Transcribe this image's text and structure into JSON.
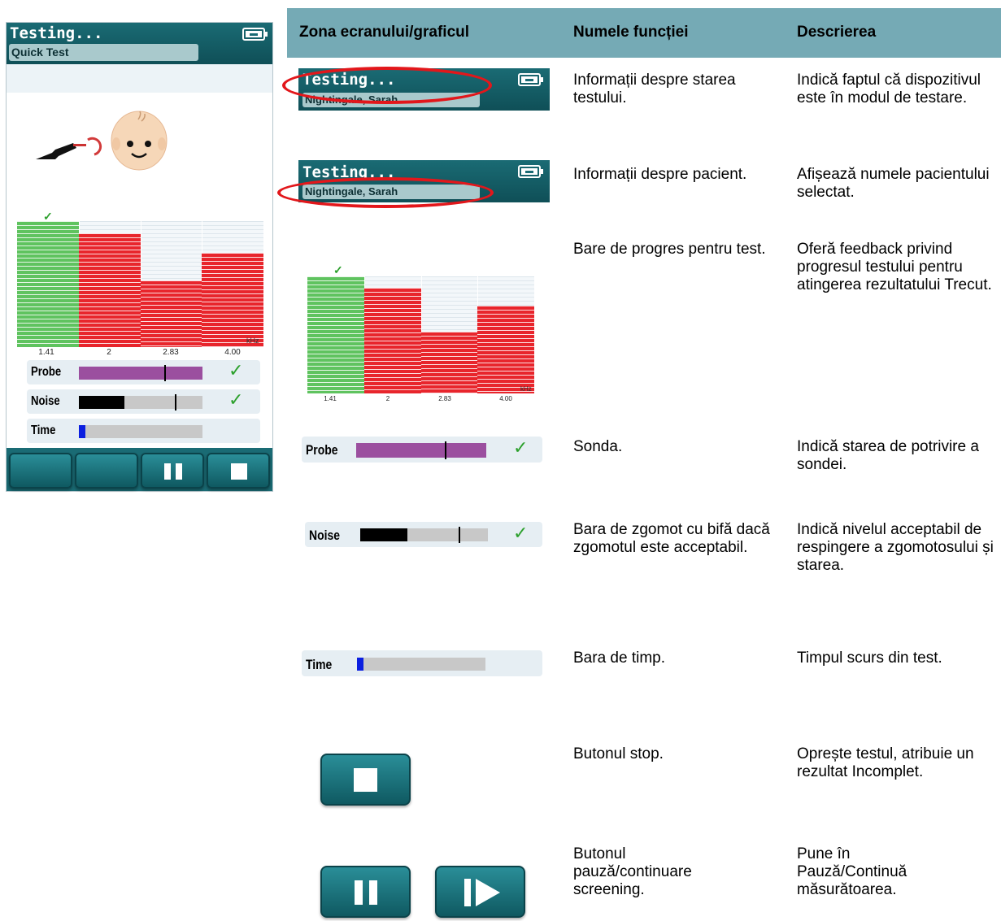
{
  "device": {
    "title": "Testing...",
    "subtitle": "Quick Test",
    "chart_labels": [
      "1.41",
      "2",
      "2.83",
      "4.00"
    ],
    "unit": "kHz",
    "rows": [
      {
        "label": "Probe"
      },
      {
        "label": "Noise"
      },
      {
        "label": "Time"
      }
    ]
  },
  "table": {
    "headers": [
      "Zona ecranului/graficul",
      "Numele funcției",
      "Descrierea"
    ],
    "rows": [
      {
        "name": "Informații despre starea testului.",
        "desc": "Indică faptul că dispozitivul este în modul de testare."
      },
      {
        "name": "Informații despre pacient.",
        "desc": "Afișează numele pacientului selectat."
      },
      {
        "name": "Bare de progres pentru test.",
        "desc": "Oferă feedback privind progresul testului pentru atingerea rezultatului Trecut."
      },
      {
        "name": "Sonda.",
        "desc": "Indică starea de potrivire a sondei."
      },
      {
        "name": "Bara de zgomot cu bifă dacă zgomotul este acceptabil.",
        "desc": "Indică nivelul acceptabil de respingere a zgomotosului și starea."
      },
      {
        "name": "Bara de timp.",
        "desc": "Timpul scurs din test."
      },
      {
        "name": "Butonul stop.",
        "desc": "Oprește testul, atribuie un rezultat Incomplet."
      },
      {
        "name": "Butonul pauză/continuare screening.",
        "desc": "Pune în Pauză/Continuă măsurătoarea."
      }
    ],
    "samples": {
      "title": "Testing...",
      "patient": "Nightingale, Sarah",
      "probe_label": "Probe",
      "noise_label": "Noise",
      "time_label": "Time"
    }
  },
  "chart_data": {
    "type": "bar",
    "categories": [
      "1.41",
      "2",
      "2.83",
      "4.00"
    ],
    "values": [
      100,
      90,
      53,
      75
    ],
    "bar_colors": [
      "#5fc35f",
      "#e8252c",
      "#e8252c",
      "#e8252c"
    ],
    "xlabel": "kHz",
    "ylim": [
      0,
      100
    ]
  },
  "levels": {
    "probe": {
      "fill": 1.0,
      "marker": 0.69
    },
    "noise": {
      "fill": 0.37,
      "marker": 0.77
    },
    "time": {
      "fill": 0.05
    }
  },
  "colors": {
    "header": "#1a6b74",
    "table_header": "#75aab5",
    "probe": "#9b4f9f",
    "noise": "#000000",
    "time": "#0b1fe0",
    "check": "#2ca02c",
    "oval": "#e2171b"
  }
}
